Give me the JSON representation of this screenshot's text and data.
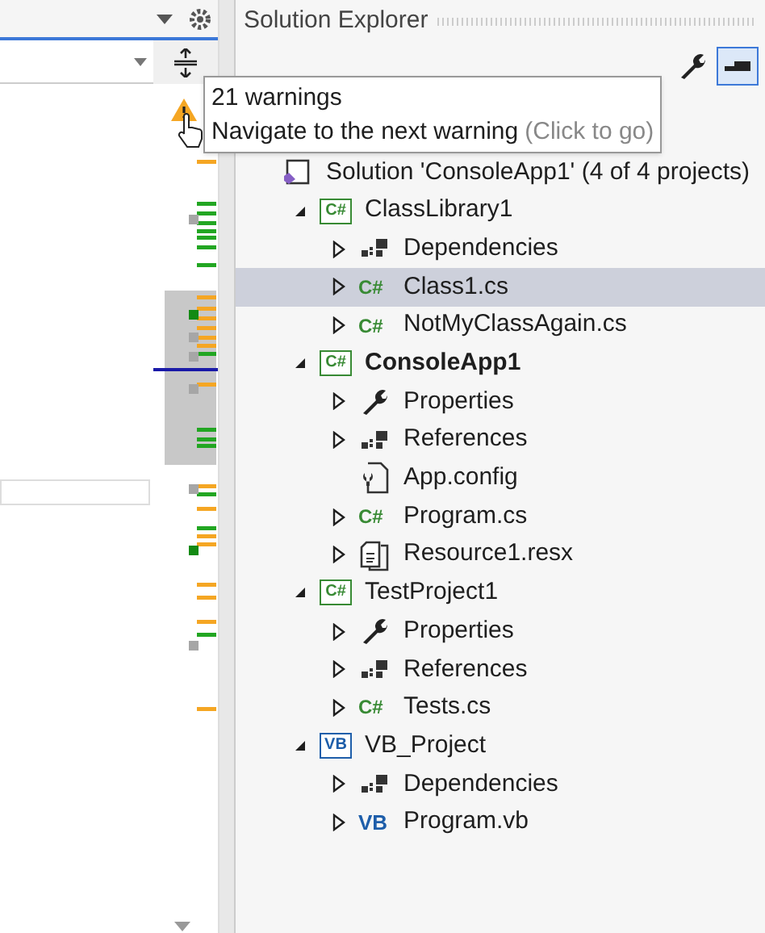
{
  "panel": {
    "title": "Solution Explorer"
  },
  "tooltip": {
    "heading": "21 warnings",
    "text": "Navigate to the next warning",
    "hint": "(Click to go)"
  },
  "tree": [
    {
      "label": "Solution 'ConsoleApp1' (4 of 4 projects)",
      "kind": "solution",
      "selected": false,
      "bold": false,
      "children": [
        {
          "label": "ClassLibrary1",
          "kind": "project",
          "badge": "C#",
          "expanded": true,
          "selected": false,
          "bold": false,
          "children": [
            {
              "label": "Dependencies",
              "kind": "dependencies",
              "expanded": false,
              "selected": false,
              "bold": false
            },
            {
              "label": "Class1.cs",
              "kind": "file",
              "badge": "C#",
              "expanded": false,
              "selected": true,
              "bold": false
            },
            {
              "label": "NotMyClassAgain.cs",
              "kind": "file",
              "badge": "C#",
              "expanded": false,
              "selected": false,
              "bold": false
            }
          ]
        },
        {
          "label": "ConsoleApp1",
          "kind": "project",
          "badge": "C#",
          "expanded": true,
          "selected": false,
          "bold": true,
          "children": [
            {
              "label": "Properties",
              "kind": "properties",
              "expanded": false,
              "selected": false,
              "bold": false
            },
            {
              "label": "References",
              "kind": "dependencies",
              "expanded": false,
              "selected": false,
              "bold": false
            },
            {
              "label": "App.config",
              "kind": "config",
              "selected": false,
              "bold": false
            },
            {
              "label": "Program.cs",
              "kind": "file",
              "badge": "C#",
              "expanded": false,
              "selected": false,
              "bold": false
            },
            {
              "label": "Resource1.resx",
              "kind": "resource",
              "expanded": false,
              "selected": false,
              "bold": false
            }
          ]
        },
        {
          "label": "TestProject1",
          "kind": "project",
          "badge": "C#",
          "expanded": true,
          "selected": false,
          "bold": false,
          "children": [
            {
              "label": "Properties",
              "kind": "properties",
              "expanded": false,
              "selected": false,
              "bold": false
            },
            {
              "label": "References",
              "kind": "dependencies",
              "expanded": false,
              "selected": false,
              "bold": false
            },
            {
              "label": "Tests.cs",
              "kind": "file",
              "badge": "C#",
              "expanded": false,
              "selected": false,
              "bold": false
            }
          ]
        },
        {
          "label": "VB_Project",
          "kind": "vbproject",
          "badge": "VB",
          "expanded": true,
          "selected": false,
          "bold": false,
          "children": [
            {
              "label": "Dependencies",
              "kind": "dependencies",
              "expanded": false,
              "selected": false,
              "bold": false
            },
            {
              "label": "Program.vb",
              "kind": "vbfile",
              "badge": "VB",
              "expanded": false,
              "selected": false,
              "bold": false
            }
          ]
        }
      ]
    }
  ]
}
